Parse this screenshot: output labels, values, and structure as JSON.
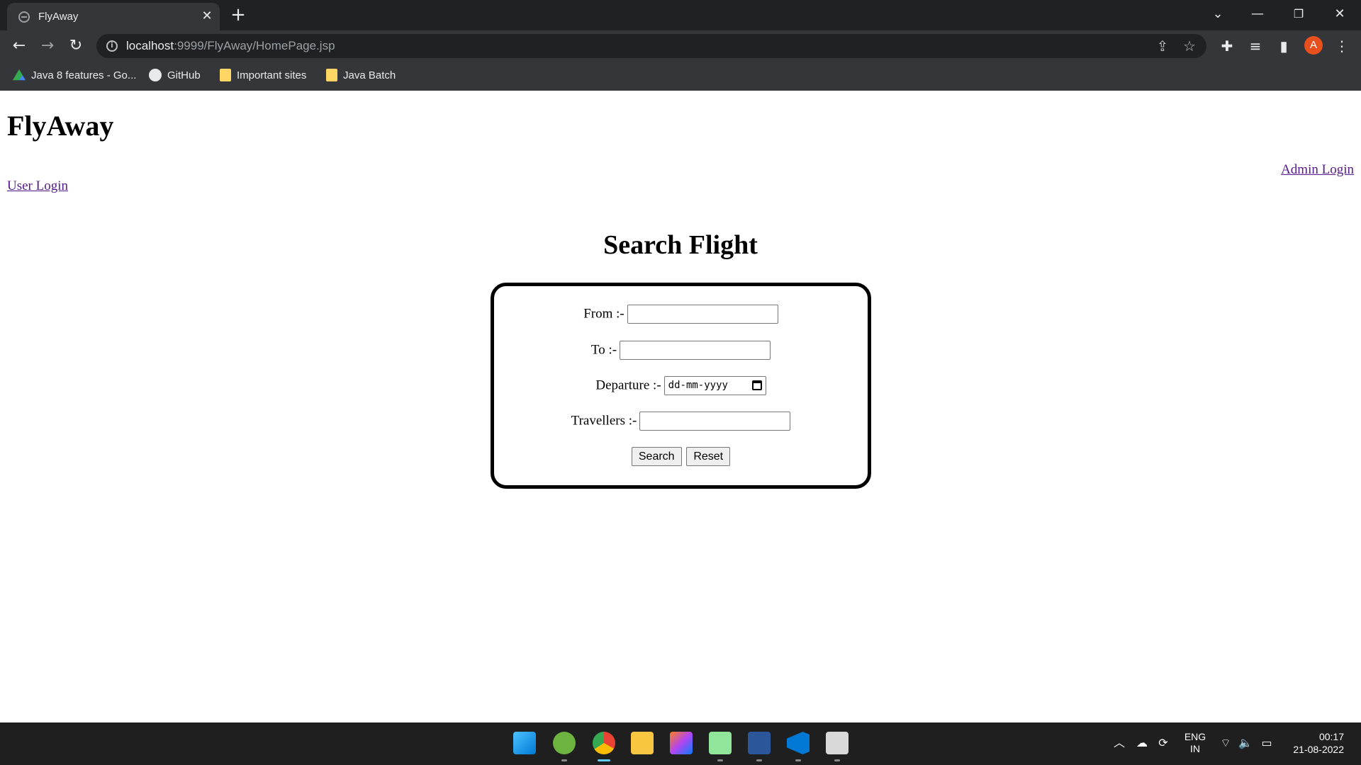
{
  "browser": {
    "tab_title": "FlyAway",
    "url_host": "localhost",
    "url_path": ":9999/FlyAway/HomePage.jsp",
    "bookmarks": [
      {
        "label": "Java 8 features - Go...",
        "icon": "google-drive-icon"
      },
      {
        "label": "GitHub",
        "icon": "github-icon"
      },
      {
        "label": "Important sites",
        "icon": "folder-icon"
      },
      {
        "label": "Java Batch",
        "icon": "folder-icon"
      }
    ],
    "profile_initial": "A"
  },
  "page": {
    "site_title": "FlyAway",
    "admin_login": "Admin Login",
    "user_login": "User Login",
    "heading": "Search Flight",
    "form": {
      "from_label": "From :-",
      "to_label": "To :-",
      "departure_label": "Departure :-",
      "departure_placeholder": "dd-mm-yyyy",
      "travellers_label": "Travellers :-",
      "search_button": "Search",
      "reset_button": "Reset"
    }
  },
  "taskbar": {
    "apps": [
      "windows-start-icon",
      "spring-tools-icon",
      "chrome-icon",
      "file-explorer-icon",
      "intellij-icon",
      "notepad-plus-icon",
      "word-icon",
      "vscode-icon",
      "media-player-icon"
    ],
    "language_line1": "ENG",
    "language_line2": "IN",
    "time": "00:17",
    "date": "21-08-2022"
  },
  "colors": {
    "link_visited": "#551a8b",
    "chrome_dark": "#202124",
    "chrome_toolbar": "#35363a",
    "avatar": "#e8501e",
    "taskbar": "#1f1f1f"
  }
}
